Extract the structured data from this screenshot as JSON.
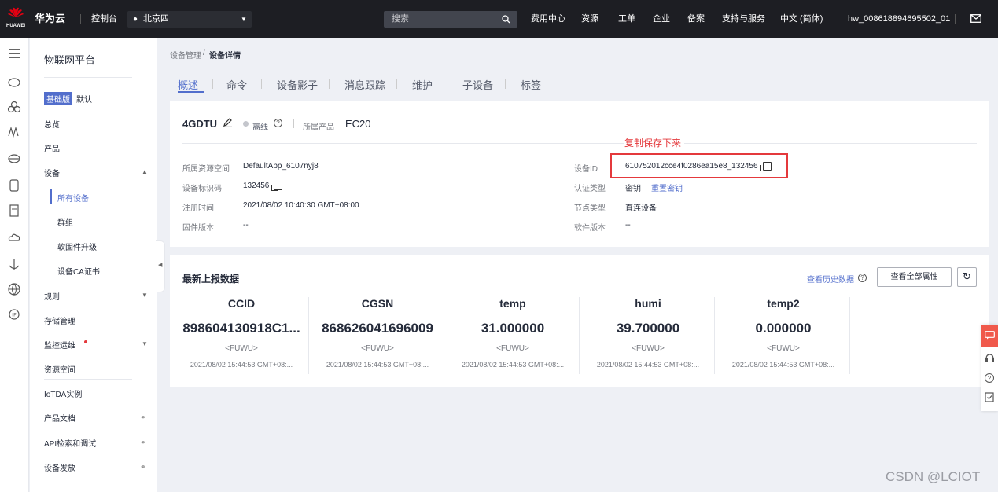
{
  "topbar": {
    "logo_text": "HUAWEI",
    "brand": "华为云",
    "console": "控制台",
    "region": "北京四",
    "search_placeholder": "搜索",
    "links": [
      "费用中心",
      "资源",
      "工单",
      "企业",
      "备案",
      "支持与服务",
      "中文 (简体)"
    ],
    "user": "hw_008618894695502_01"
  },
  "sidenav": {
    "title": "物联网平台",
    "edition_badge": "基础版",
    "edition_default": "默认",
    "items": [
      "总览",
      "产品",
      "设备",
      "所有设备",
      "群组",
      "软固件升级",
      "设备CA证书",
      "规则",
      "存储管理",
      "监控运维",
      "资源空间",
      "IoTDA实例",
      "产品文档",
      "API检索和调试",
      "设备发放"
    ]
  },
  "breadcrumb": {
    "parent": "设备管理",
    "current": "设备详情"
  },
  "tabs": [
    "概述",
    "命令",
    "设备影子",
    "消息跟踪",
    "维护",
    "子设备",
    "标签"
  ],
  "device": {
    "name": "4GDTU",
    "status": "离线",
    "product_label": "所属产品",
    "product": "EC20",
    "annotation": "复制保存下来",
    "space_label": "所属资源空间",
    "space": "DefaultApp_6107nyj8",
    "node_id_label": "设备标识码",
    "node_id": "132456",
    "reg_label": "注册时间",
    "reg_time": "2021/08/02 10:40:30 GMT+08:00",
    "fw_label": "固件版本",
    "fw": "--",
    "id_label": "设备ID",
    "device_id": "610752012cce4f0286ea15e8_132456",
    "auth_label": "认证类型",
    "auth": "密钥",
    "reset_secret": "重置密钥",
    "node_type_label": "节点类型",
    "node_type": "直连设备",
    "sw_label": "软件版本",
    "sw": "--"
  },
  "latest": {
    "title": "最新上报数据",
    "history_link": "查看历史数据",
    "all_props_button": "查看全部属性",
    "metrics": [
      {
        "name": "CCID",
        "value": "898604130918C1...",
        "service": "<FUWU>",
        "time": "2021/08/02 15:44:53 GMT+08:..."
      },
      {
        "name": "CGSN",
        "value": "868626041696009",
        "service": "<FUWU>",
        "time": "2021/08/02 15:44:53 GMT+08:..."
      },
      {
        "name": "temp",
        "value": "31.000000",
        "service": "<FUWU>",
        "time": "2021/08/02 15:44:53 GMT+08:..."
      },
      {
        "name": "humi",
        "value": "39.700000",
        "service": "<FUWU>",
        "time": "2021/08/02 15:44:53 GMT+08:..."
      },
      {
        "name": "temp2",
        "value": "0.000000",
        "service": "<FUWU>",
        "time": "2021/08/02 15:44:53 GMT+08:..."
      }
    ]
  },
  "watermark": "CSDN @LCIOT",
  "colors": {
    "topbar": "#1d1e23",
    "accent": "#526ecc",
    "annotation": "#e4393c"
  }
}
